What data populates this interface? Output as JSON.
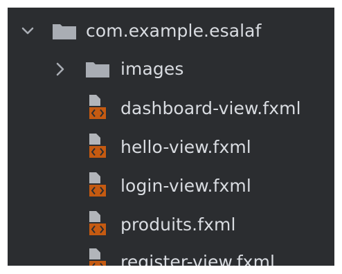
{
  "tree": {
    "root": {
      "label": "com.example.esalaf",
      "expanded": true,
      "chevron_icon": "chevron-down-icon",
      "icon": "folder-icon"
    },
    "children": [
      {
        "type": "folder",
        "label": "images",
        "expanded": false,
        "chevron_icon": "chevron-right-icon",
        "icon": "folder-icon"
      },
      {
        "type": "file",
        "label": "dashboard-view.fxml",
        "icon": "fxml-file-icon"
      },
      {
        "type": "file",
        "label": "hello-view.fxml",
        "icon": "fxml-file-icon"
      },
      {
        "type": "file",
        "label": "login-view.fxml",
        "icon": "fxml-file-icon"
      },
      {
        "type": "file",
        "label": "produits.fxml",
        "icon": "fxml-file-icon"
      },
      {
        "type": "file",
        "label": "register-view.fxml",
        "icon": "fxml-file-icon"
      }
    ]
  },
  "colors": {
    "background": "#2b2d30",
    "text": "#d9dce1",
    "folder": "#a9adb4",
    "chevron": "#a9adb4",
    "fxml_base": "#c55a11",
    "fxml_doc": "#b2b5ba"
  }
}
